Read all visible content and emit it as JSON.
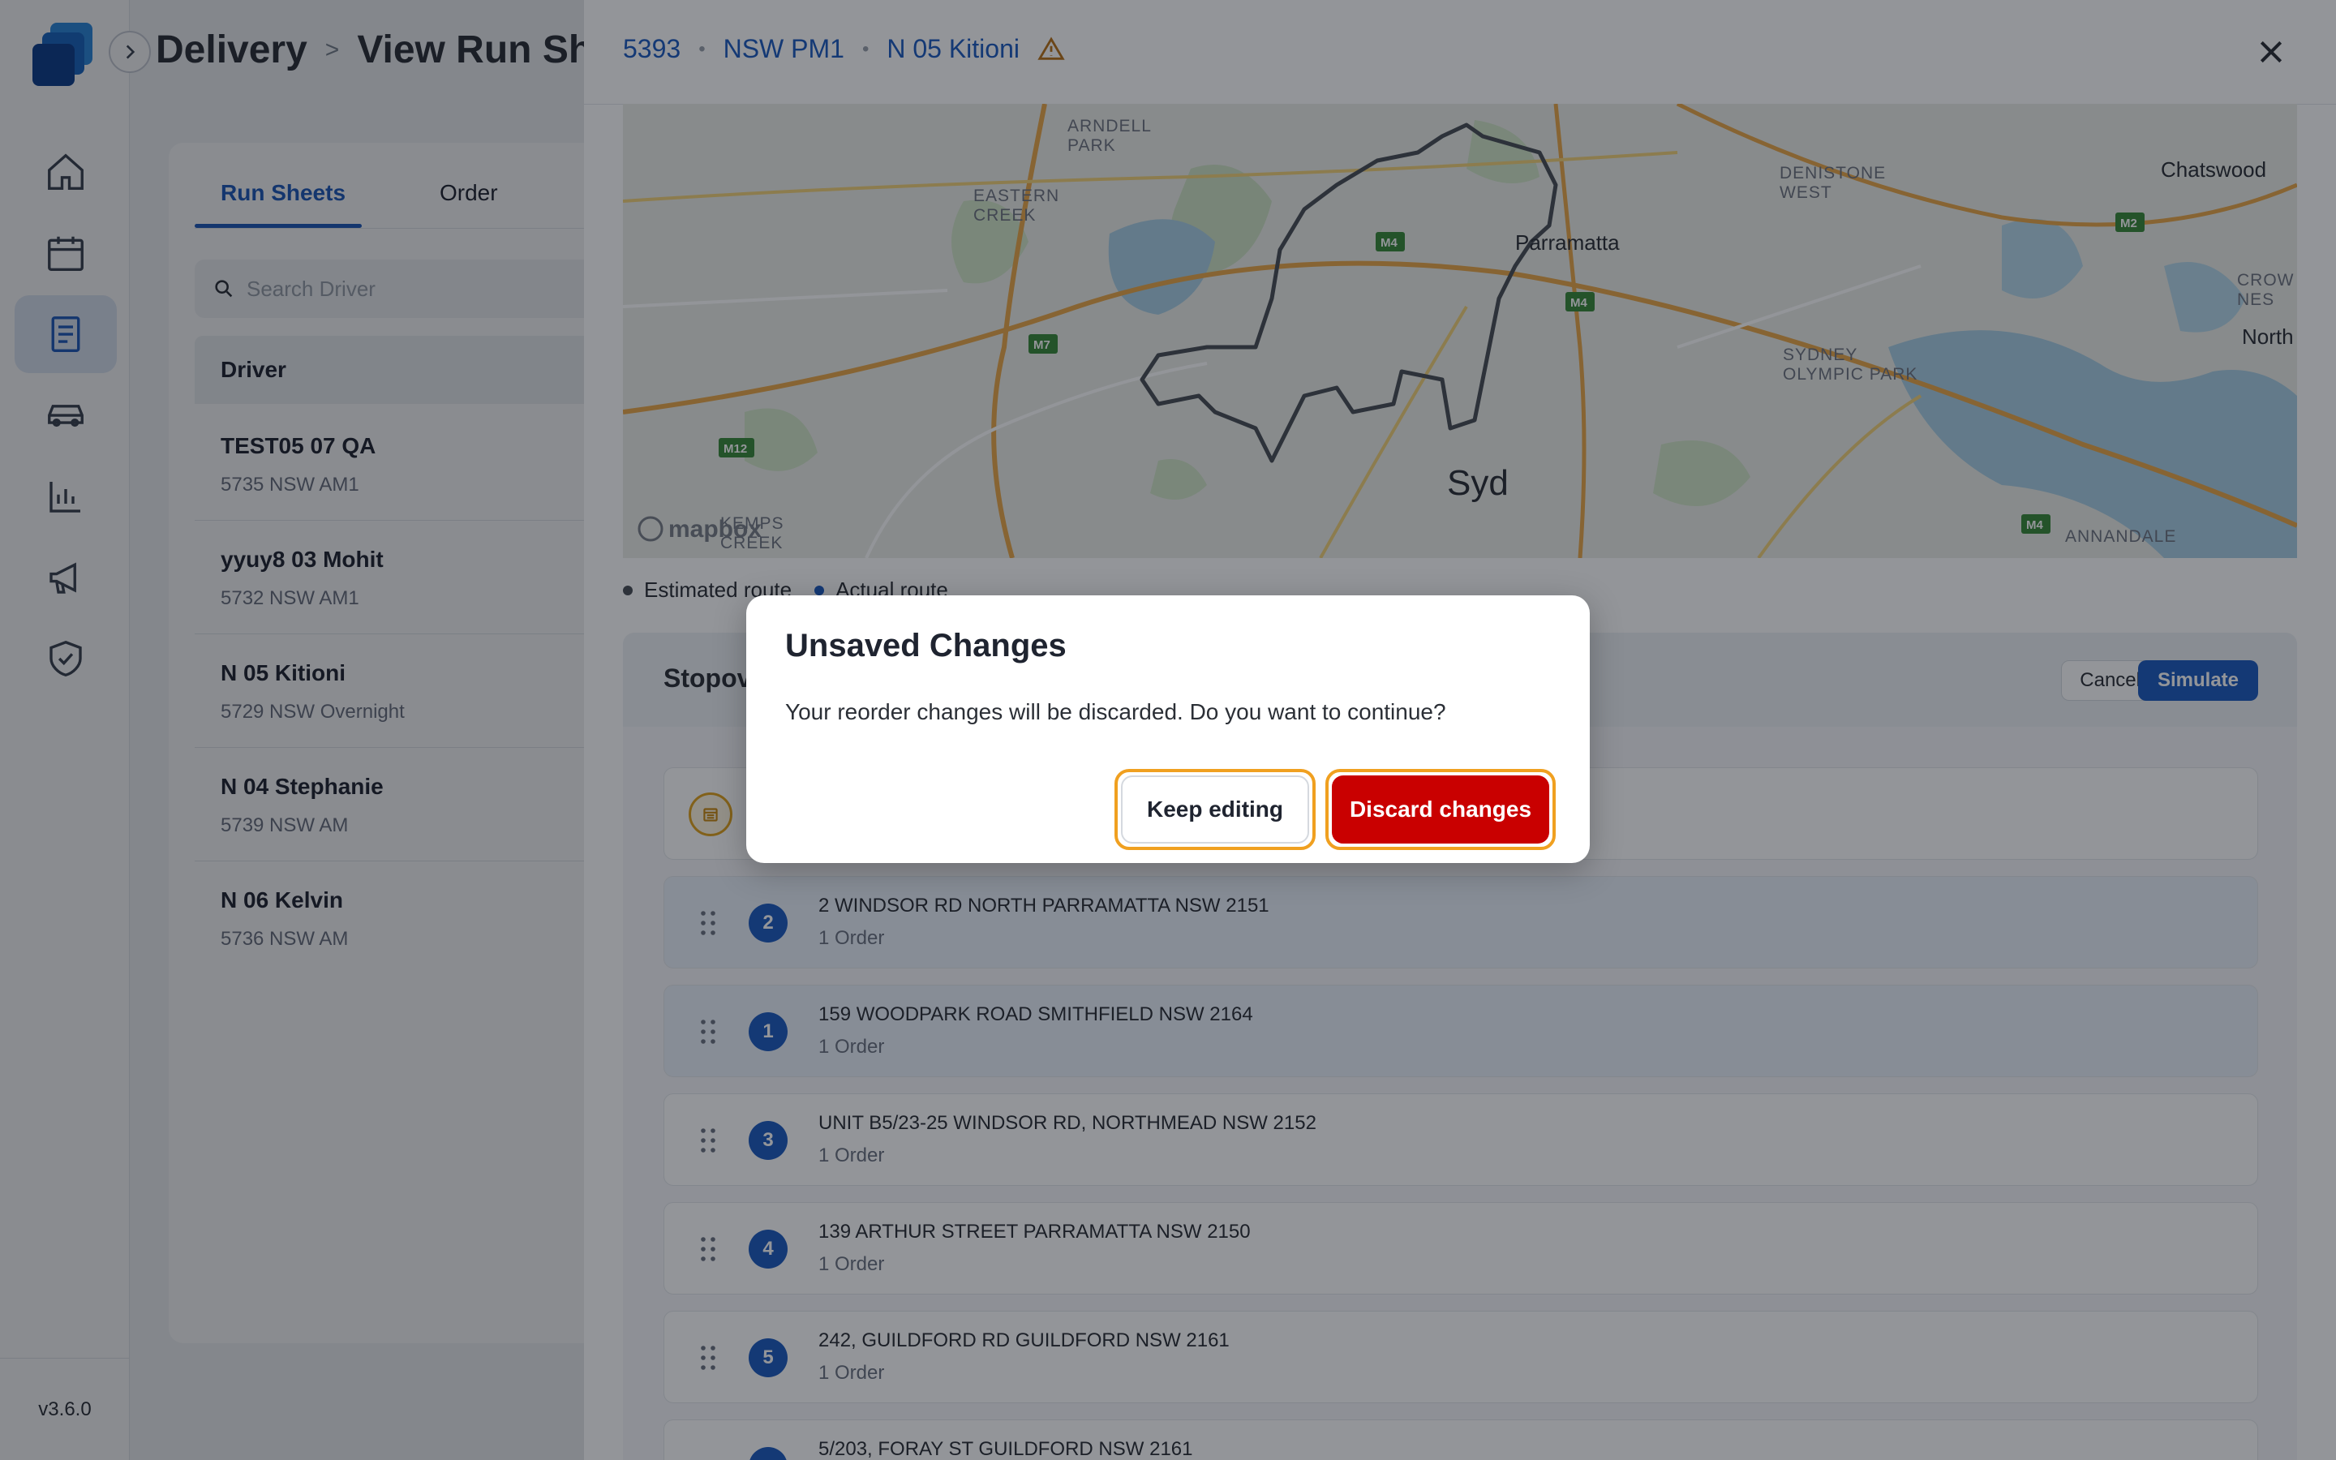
{
  "app": {
    "version": "v3.6.0",
    "colors": {
      "accent": "#1d5bbf",
      "danger": "#c90000",
      "focus_ring": "#f0a020"
    }
  },
  "sidebar": {
    "items": [
      {
        "icon": "home-icon"
      },
      {
        "icon": "calendar-icon"
      },
      {
        "icon": "run-sheet-icon",
        "active": true
      },
      {
        "icon": "car-icon"
      },
      {
        "icon": "bar-chart-icon"
      },
      {
        "icon": "megaphone-icon"
      },
      {
        "icon": "shield-check-icon"
      }
    ]
  },
  "header": {
    "breadcrumb_root": "Delivery",
    "breadcrumb_sep": ">",
    "page_title": "View Run She"
  },
  "left_panel": {
    "tabs": [
      {
        "label": "Run Sheets",
        "active": true
      },
      {
        "label": "Order"
      }
    ],
    "search_placeholder": "Search Driver",
    "column_header": "Driver",
    "drivers": [
      {
        "name": "TEST05 07 QA",
        "sub": "5735 NSW AM1"
      },
      {
        "name": "yyuy8 03 Mohit",
        "sub": "5732 NSW AM1"
      },
      {
        "name": "N 05 Kitioni",
        "sub": "5729 NSW Overnight"
      },
      {
        "name": "N 04 Stephanie",
        "sub": "5739 NSW AM"
      },
      {
        "name": "N 06 Kelvin",
        "sub": "5736 NSW AM"
      }
    ]
  },
  "drawer": {
    "run_id": "5393",
    "run_name": "NSW PM1",
    "driver_name": "N 05 Kitioni",
    "warning_icon": "warning-triangle-icon",
    "map": {
      "labels": {
        "arndell_park": "ARNDELL\nPARK",
        "eastern_creek": "EASTERN\nCREEK",
        "parramatta": "Parramatta",
        "denistone_west": "DENISTONE\nWEST",
        "chatswood": "Chatswood",
        "sydney_olympic_park": "SYDNEY\nOLYMPIC PARK",
        "north": "North",
        "crows": "CROW\nNES",
        "kemps_creek": "KEMPS\nCREEK",
        "annandale": "ANNANDALE",
        "syd": "Syd",
        "mapbox": "mapbox"
      },
      "shields": [
        "M4",
        "M4",
        "M7",
        "M12",
        "M2",
        "M4"
      ]
    },
    "legend": {
      "estimated": "Estimated route",
      "actual": "Actual route"
    },
    "stopovers_title": "Stopov",
    "cancel_label": "Cancel",
    "simulate_label": "Simulate",
    "stops": [
      {
        "num": "2",
        "address": "2 WINDSOR RD NORTH PARRAMATTA NSW 2151",
        "orders": "1 Order"
      },
      {
        "num": "1",
        "address": "159 WOODPARK ROAD SMITHFIELD NSW 2164",
        "orders": "1 Order"
      },
      {
        "num": "3",
        "address": "UNIT B5/23-25 WINDSOR RD, NORTHMEAD NSW 2152",
        "orders": "1 Order"
      },
      {
        "num": "4",
        "address": "139 ARTHUR STREET PARRAMATTA NSW 2150",
        "orders": "1 Order"
      },
      {
        "num": "5",
        "address": "242, GUILDFORD RD GUILDFORD NSW 2161",
        "orders": "1 Order"
      },
      {
        "num": "",
        "address": "5/203, FORAY ST GUILDFORD NSW 2161",
        "orders": ""
      }
    ]
  },
  "modal": {
    "title": "Unsaved Changes",
    "body": "Your reorder changes will be discarded. Do you want to continue?",
    "keep_label": "Keep editing",
    "discard_label": "Discard changes"
  }
}
